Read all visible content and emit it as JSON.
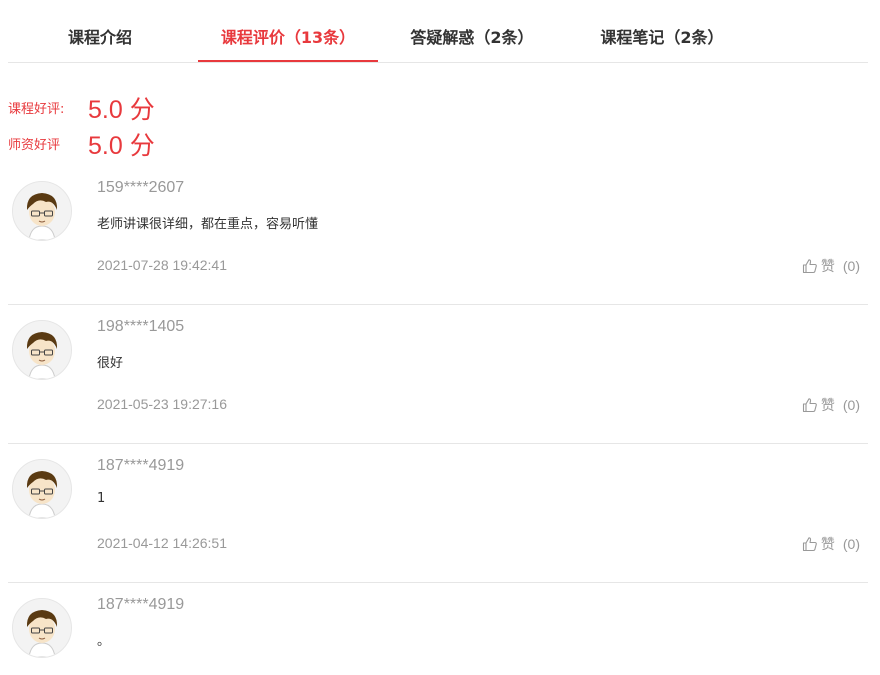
{
  "tabs": [
    {
      "label": "课程介绍",
      "active": false
    },
    {
      "label": "课程评价（13条）",
      "active": true
    },
    {
      "label": "答疑解惑（2条）",
      "active": false
    },
    {
      "label": "课程笔记（2条）",
      "active": false
    }
  ],
  "ratings": [
    {
      "label": "课程好评:",
      "value": "5.0 分"
    },
    {
      "label": "师资好评",
      "value": "5.0 分"
    }
  ],
  "reviews": [
    {
      "user": "159****2607",
      "content": "老师讲课很详细，都在重点，容易听懂",
      "time": "2021-07-28 19:42:41",
      "like_label": "赞",
      "like_count": "(0)"
    },
    {
      "user": "198****1405",
      "content": "很好",
      "time": "2021-05-23 19:27:16",
      "like_label": "赞",
      "like_count": "(0)"
    },
    {
      "user": "187****4919",
      "content": "1",
      "time": "2021-04-12 14:26:51",
      "like_label": "赞",
      "like_count": "(0)"
    },
    {
      "user": "187****4919",
      "content": "。",
      "time": "",
      "like_label": "",
      "like_count": ""
    }
  ],
  "colors": {
    "accent": "#e8393d",
    "muted": "#999999",
    "divider": "#e6e6e6"
  },
  "icons": {
    "avatar": "cartoon-boy-avatar-icon",
    "like": "thumbs-up-icon"
  }
}
